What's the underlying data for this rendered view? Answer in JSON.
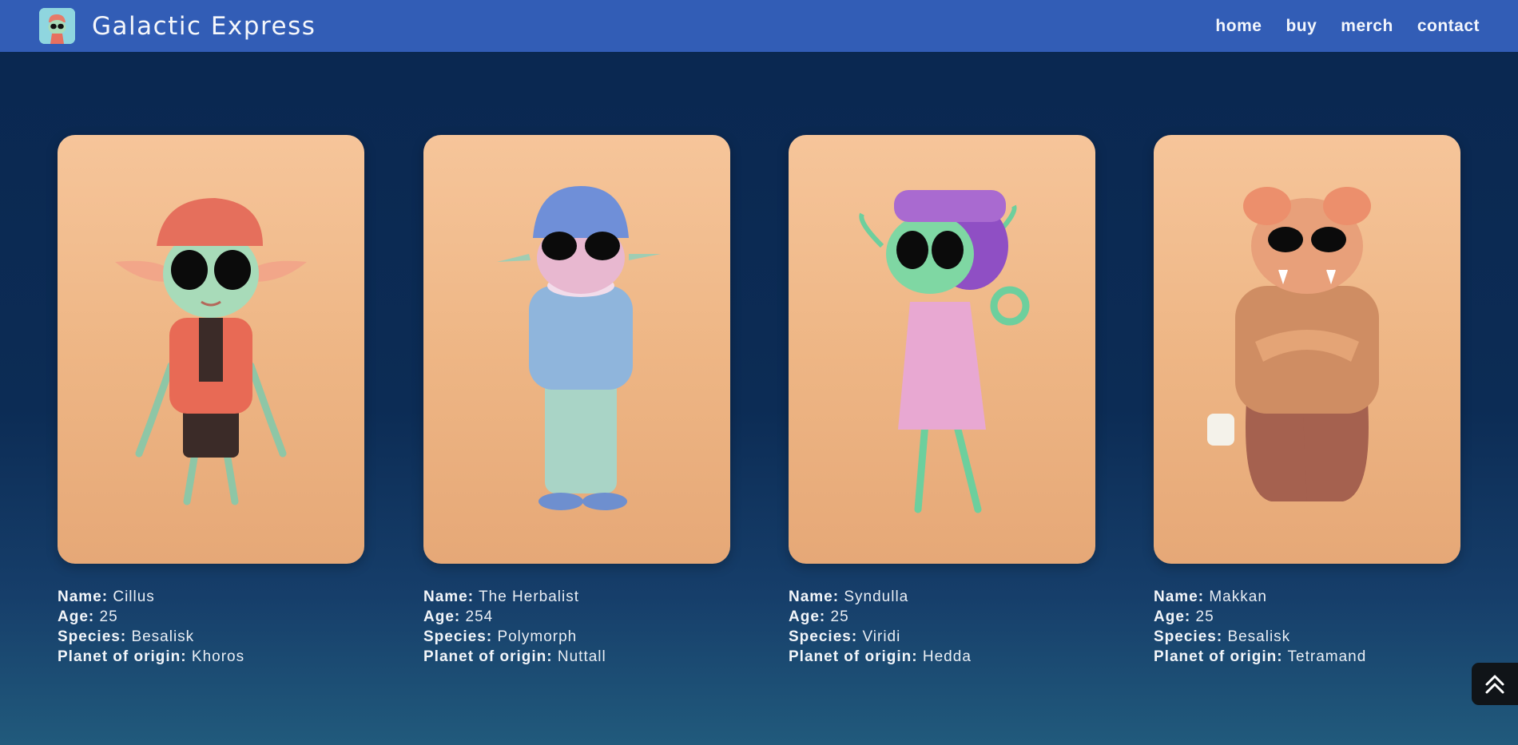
{
  "brand": {
    "title": "Galactic Express"
  },
  "nav": {
    "home": "home",
    "buy": "buy",
    "merch": "merch",
    "contact": "contact"
  },
  "labels": {
    "name": "Name:",
    "age": "Age:",
    "species": "Species:",
    "planet": "Planet of origin:"
  },
  "characters": [
    {
      "name": "Cillus",
      "age": "25",
      "species": "Besalisk",
      "planet": "Khoros"
    },
    {
      "name": "The Herbalist",
      "age": "254",
      "species": "Polymorph",
      "planet": "Nuttall"
    },
    {
      "name": "Syndulla",
      "age": "25",
      "species": "Viridi",
      "planet": "Hedda"
    },
    {
      "name": "Makkan",
      "age": "25",
      "species": "Besalisk",
      "planet": "Tetramand"
    }
  ],
  "icons": {
    "scroll_top": "double-chevron-up-icon"
  },
  "colors": {
    "navbar": "#325db6",
    "background": "#0a2750",
    "card": "#f0b98a"
  }
}
